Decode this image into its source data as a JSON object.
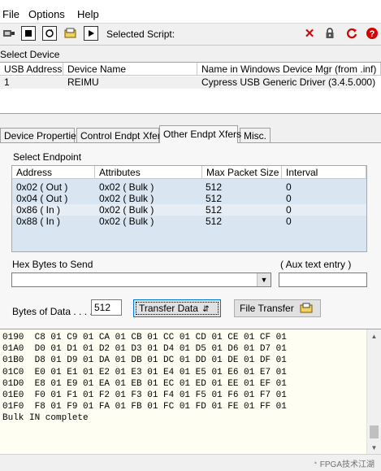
{
  "menu": [
    "File",
    "Options",
    "Help"
  ],
  "toolbar": {
    "selected_script_label": "Selected Script:",
    "left_icons": [
      "usb-connect-icon",
      "stop-icon",
      "reset-icon",
      "load-script-icon",
      "play-script-icon"
    ],
    "right_icons": [
      "delete-icon",
      "lock-icon",
      "refresh-icon",
      "help-icon"
    ],
    "accent_red": "#d40000"
  },
  "select_device": {
    "label": "Select Device",
    "columns": [
      "USB Address",
      "Device Name",
      "Name in Windows Device Mgr (from .inf)"
    ],
    "rows": [
      {
        "address": "1",
        "name": "REIMU",
        "win_name": "Cypress USB Generic Driver (3.4.5.000)"
      }
    ]
  },
  "tabs": [
    "Device Properties",
    "Control Endpt Xfers",
    "Other Endpt Xfers",
    "Misc."
  ],
  "active_tab": "Other Endpt Xfers",
  "endpoint": {
    "label": "Select Endpoint",
    "columns": [
      "Address",
      "Attributes",
      "Max Packet Size",
      "Interval"
    ],
    "rows": [
      {
        "address": "0x02 ( Out )",
        "attributes": "0x02  ( Bulk )",
        "max_packet": "512",
        "interval": "0"
      },
      {
        "address": "0x04 ( Out )",
        "attributes": "0x02  ( Bulk )",
        "max_packet": "512",
        "interval": "0"
      },
      {
        "address": "0x86 ( In )",
        "attributes": "0x02  ( Bulk )",
        "max_packet": "512",
        "interval": "0"
      },
      {
        "address": "0x88 ( In )",
        "attributes": "0x02  ( Bulk )",
        "max_packet": "512",
        "interval": "0"
      }
    ],
    "selected_row": 2
  },
  "hex_bytes_label": "Hex Bytes to Send",
  "hex_bytes_value": "",
  "aux_label": "( Aux text entry )",
  "aux_value": "",
  "bytes_of_data_label": "Bytes of Data . . . .",
  "bytes_of_data_value": "512",
  "transfer_button": "Transfer Data",
  "file_transfer_button": "File Transfer",
  "output": {
    "lines": [
      "0190  C8 01 C9 01 CA 01 CB 01 CC 01 CD 01 CE 01 CF 01",
      "01A0  D0 01 D1 01 D2 01 D3 01 D4 01 D5 01 D6 01 D7 01",
      "01B0  D8 01 D9 01 DA 01 DB 01 DC 01 DD 01 DE 01 DF 01",
      "01C0  E0 01 E1 01 E2 01 E3 01 E4 01 E5 01 E6 01 E7 01",
      "01D0  E8 01 E9 01 EA 01 EB 01 EC 01 ED 01 EE 01 EF 01",
      "01E0  F0 01 F1 01 F2 01 F3 01 F4 01 F5 01 F6 01 F7 01",
      "01F0  F8 01 F9 01 FA 01 FB 01 FC 01 FD 01 FE 01 FF 01",
      "Bulk IN complete"
    ]
  },
  "watermark": "FPGA技术江湖"
}
